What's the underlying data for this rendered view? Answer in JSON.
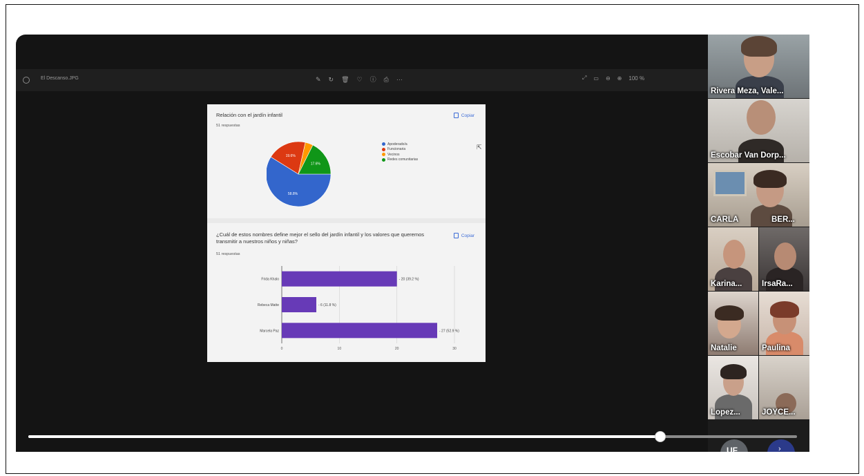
{
  "viewer": {
    "filename": "El Descanso.JPG",
    "zoom_label": "100 %",
    "toolbar_icons": [
      "edit-icon",
      "rotate-icon",
      "delete-icon",
      "favorite-icon",
      "info-icon",
      "print-icon",
      "more-icon"
    ],
    "right_icons": [
      "expand-icon",
      "fit-icon",
      "zoom-out-icon",
      "zoom-in-icon"
    ]
  },
  "slide": {
    "q1": {
      "title": "Relación con el jardín infantil",
      "responses": "51 respuestas",
      "copy_label": "Copiar",
      "chart_data": {
        "type": "pie",
        "slices": [
          {
            "label": "Apoderado/a",
            "value": 58.8,
            "display": "58.8%",
            "color": "#3366cc"
          },
          {
            "label": "Funcionaria",
            "value": 19.6,
            "display": "19.6%",
            "color": "#dc3912"
          },
          {
            "label": "Vecinos",
            "value": 3.9,
            "display": "",
            "color": "#ff9900"
          },
          {
            "label": "Redes comunitarias",
            "value": 17.6,
            "display": "17.6%",
            "color": "#109618"
          }
        ],
        "legend_position": "right"
      }
    },
    "q2": {
      "title": "¿Cuál de estos nombres define mejor el sello del jardín infantil y los valores que queremos transmitir a nuestros niños y niñas?",
      "responses": "51 respuestas",
      "copy_label": "Copiar",
      "chart_data": {
        "type": "bar",
        "orientation": "horizontal",
        "categories": [
          "Frida Khalo",
          "Rebeca Matte",
          "Marcela Paz"
        ],
        "values": [
          20,
          6,
          27
        ],
        "value_labels": [
          "20 (39.2 %)",
          "6 (11.8 %)",
          "27 (52.9 %)"
        ],
        "xlim": [
          0,
          30
        ],
        "xticks": [
          "0",
          "10",
          "20",
          "30"
        ],
        "color": "#673ab7",
        "grid": true
      }
    }
  },
  "participants": [
    {
      "name": "Rivera Meza, Vale..."
    },
    {
      "name": "Escobar Van Dorp..."
    },
    {
      "name": "CARLA",
      "name2": "BER..."
    },
    {
      "name": "Karina...",
      "name2": "IrsaRa..."
    },
    {
      "name": "Natalie",
      "name2": "Paulina"
    },
    {
      "name": "Lopez...",
      "name2": "JOYCE..."
    }
  ],
  "avatar_initials": "UF",
  "playback": {
    "progress": 0.822
  }
}
